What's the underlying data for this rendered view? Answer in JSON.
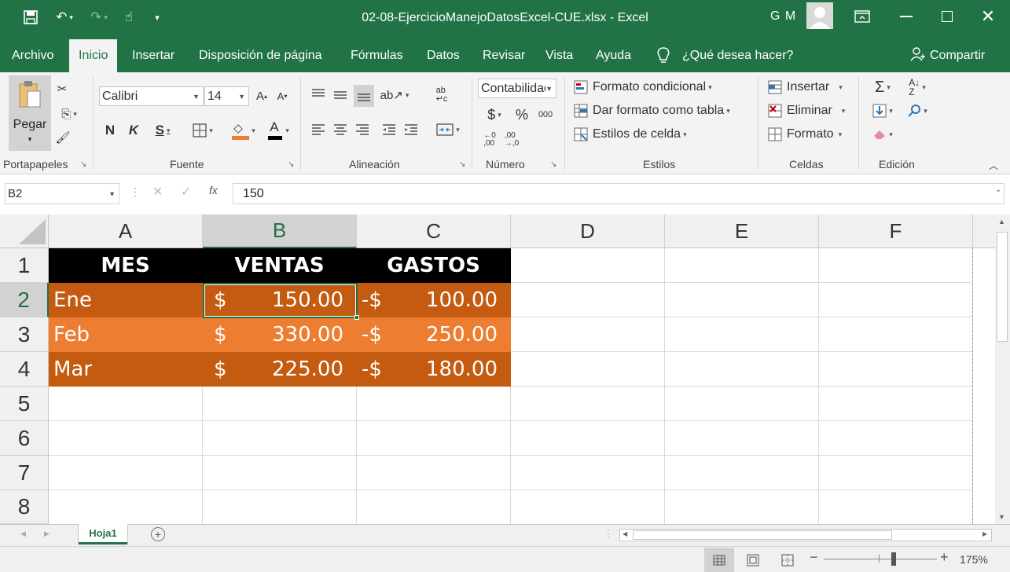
{
  "window": {
    "title": "02-08-EjercicioManejoDatosExcel-CUE.xlsx  -  Excel",
    "user_initials": "G M",
    "brand_color": "#217346"
  },
  "tabs": [
    "Archivo",
    "Inicio",
    "Insertar",
    "Disposición de página",
    "Fórmulas",
    "Datos",
    "Revisar",
    "Vista",
    "Ayuda"
  ],
  "tell_me": "¿Qué desea hacer?",
  "share": "Compartir",
  "ribbon": {
    "clipboard": {
      "paste": "Pegar",
      "label": "Portapapeles"
    },
    "font": {
      "name": "Calibri",
      "size": "14",
      "bold": "N",
      "italic": "K",
      "underline": "S",
      "label": "Fuente"
    },
    "alignment": {
      "label": "Alineación"
    },
    "number": {
      "format": "Contabilidad",
      "currency": "$",
      "percent": "%",
      "thousands": "000",
      "label": "Número"
    },
    "styles": {
      "conditional": "Formato condicional",
      "as_table": "Dar formato como tabla",
      "cell_styles": "Estilos de celda",
      "label": "Estilos"
    },
    "cells": {
      "insert": "Insertar",
      "delete": "Eliminar",
      "format": "Formato",
      "label": "Celdas"
    },
    "editing": {
      "label": "Edición"
    }
  },
  "formula_bar": {
    "name_box": "B2",
    "fx": "fx",
    "value": "150"
  },
  "columns": [
    "A",
    "B",
    "C",
    "D",
    "E",
    "F"
  ],
  "rows": [
    "1",
    "2",
    "3",
    "4",
    "5",
    "6",
    "7",
    "8"
  ],
  "table": {
    "headers": [
      "MES",
      "VENTAS",
      "GASTOS"
    ],
    "data": [
      {
        "mes": "Ene",
        "ventas_cur": "$",
        "ventas": "150.00",
        "gastos_cur": "-$",
        "gastos": "100.00"
      },
      {
        "mes": "Feb",
        "ventas_cur": "$",
        "ventas": "330.00",
        "gastos_cur": "-$",
        "gastos": "250.00"
      },
      {
        "mes": "Mar",
        "ventas_cur": "$",
        "ventas": "225.00",
        "gastos_cur": "-$",
        "gastos": "180.00"
      }
    ],
    "dark_fill": "#c55a11",
    "light_fill": "#ed7d31"
  },
  "sheet_tab": "Hoja1",
  "zoom": "175%"
}
